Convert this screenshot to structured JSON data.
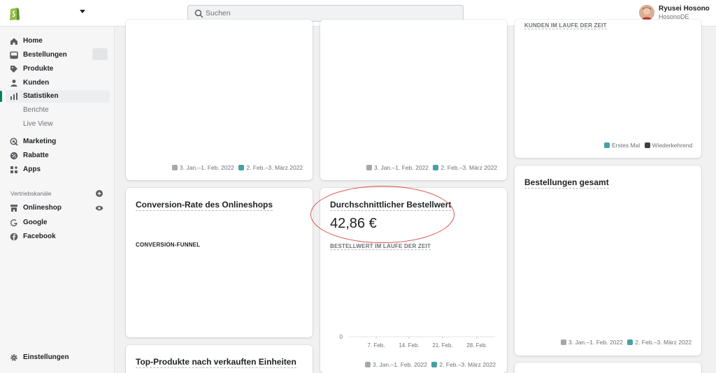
{
  "topbar": {
    "search_placeholder": "Suchen",
    "user_name": "Ryusei Hosono",
    "user_store": "HosonoDE"
  },
  "sidebar": {
    "items": [
      {
        "label": "Home",
        "icon": "home-icon"
      },
      {
        "label": "Bestellungen",
        "icon": "inbox-icon"
      },
      {
        "label": "Produkte",
        "icon": "tag-icon"
      },
      {
        "label": "Kunden",
        "icon": "person-icon"
      },
      {
        "label": "Statistiken",
        "icon": "bar-chart-icon"
      },
      {
        "label": "Berichte"
      },
      {
        "label": "Live View"
      },
      {
        "label": "Marketing",
        "icon": "target-icon"
      },
      {
        "label": "Rabatte",
        "icon": "discount-icon"
      },
      {
        "label": "Apps",
        "icon": "apps-icon"
      }
    ],
    "channels_label": "Vertriebskanäle",
    "channels": [
      {
        "label": "Onlineshop",
        "icon": "store-icon"
      },
      {
        "label": "Google",
        "icon": "google-icon"
      },
      {
        "label": "Facebook",
        "icon": "facebook-icon"
      }
    ],
    "settings_label": "Einstellungen"
  },
  "colors": {
    "previous_period": "#a4a8ab",
    "current_period": "#47a0a3",
    "returning": "#3c3f42",
    "annotation": "#d9534f"
  },
  "cards": {
    "top_left_legend": [
      "3. Jan.–1. Feb. 2022",
      "2. Feb.–3. März 2022"
    ],
    "top_middle_legend": [
      "3. Jan.–1. Feb. 2022",
      "2. Feb.–3. März 2022"
    ],
    "top_right_sub": "KUNDEN IM LAUFE DER ZEIT",
    "top_right_legend": [
      "Erstes Mal",
      "Wiederkehrend"
    ],
    "conversion": {
      "title": "Conversion-Rate des Onlineshops",
      "sub": "CONVERSION-FUNNEL"
    },
    "aov": {
      "title": "Durchschnittlicher Bestellwert",
      "value": "42,86 €",
      "sub": "BESTELLWERT IM LAUFE DER ZEIT",
      "legend": [
        "3. Jan.–1. Feb. 2022",
        "2. Feb.–3. März 2022"
      ]
    },
    "orders_total": {
      "title": "Bestellungen gesamt",
      "legend": [
        "3. Jan.–1. Feb. 2022",
        "2. Feb.–3. März 2022"
      ]
    },
    "top_products": {
      "title": "Top-Produkte nach verkauften Einheiten"
    }
  },
  "chart_data": {
    "type": "line",
    "categories": [
      "7. Feb.",
      "14. Feb.",
      "21. Feb.",
      "28. Feb."
    ],
    "y_ticks": [
      "0"
    ],
    "series": [
      {
        "name": "3. Jan.–1. Feb. 2022",
        "values": [
          0,
          0,
          0,
          0
        ]
      },
      {
        "name": "2. Feb.–3. März 2022",
        "values": [
          0,
          0,
          0,
          0
        ]
      }
    ],
    "ylim": [
      0,
      1
    ],
    "grid": true,
    "legend": "bottom"
  }
}
